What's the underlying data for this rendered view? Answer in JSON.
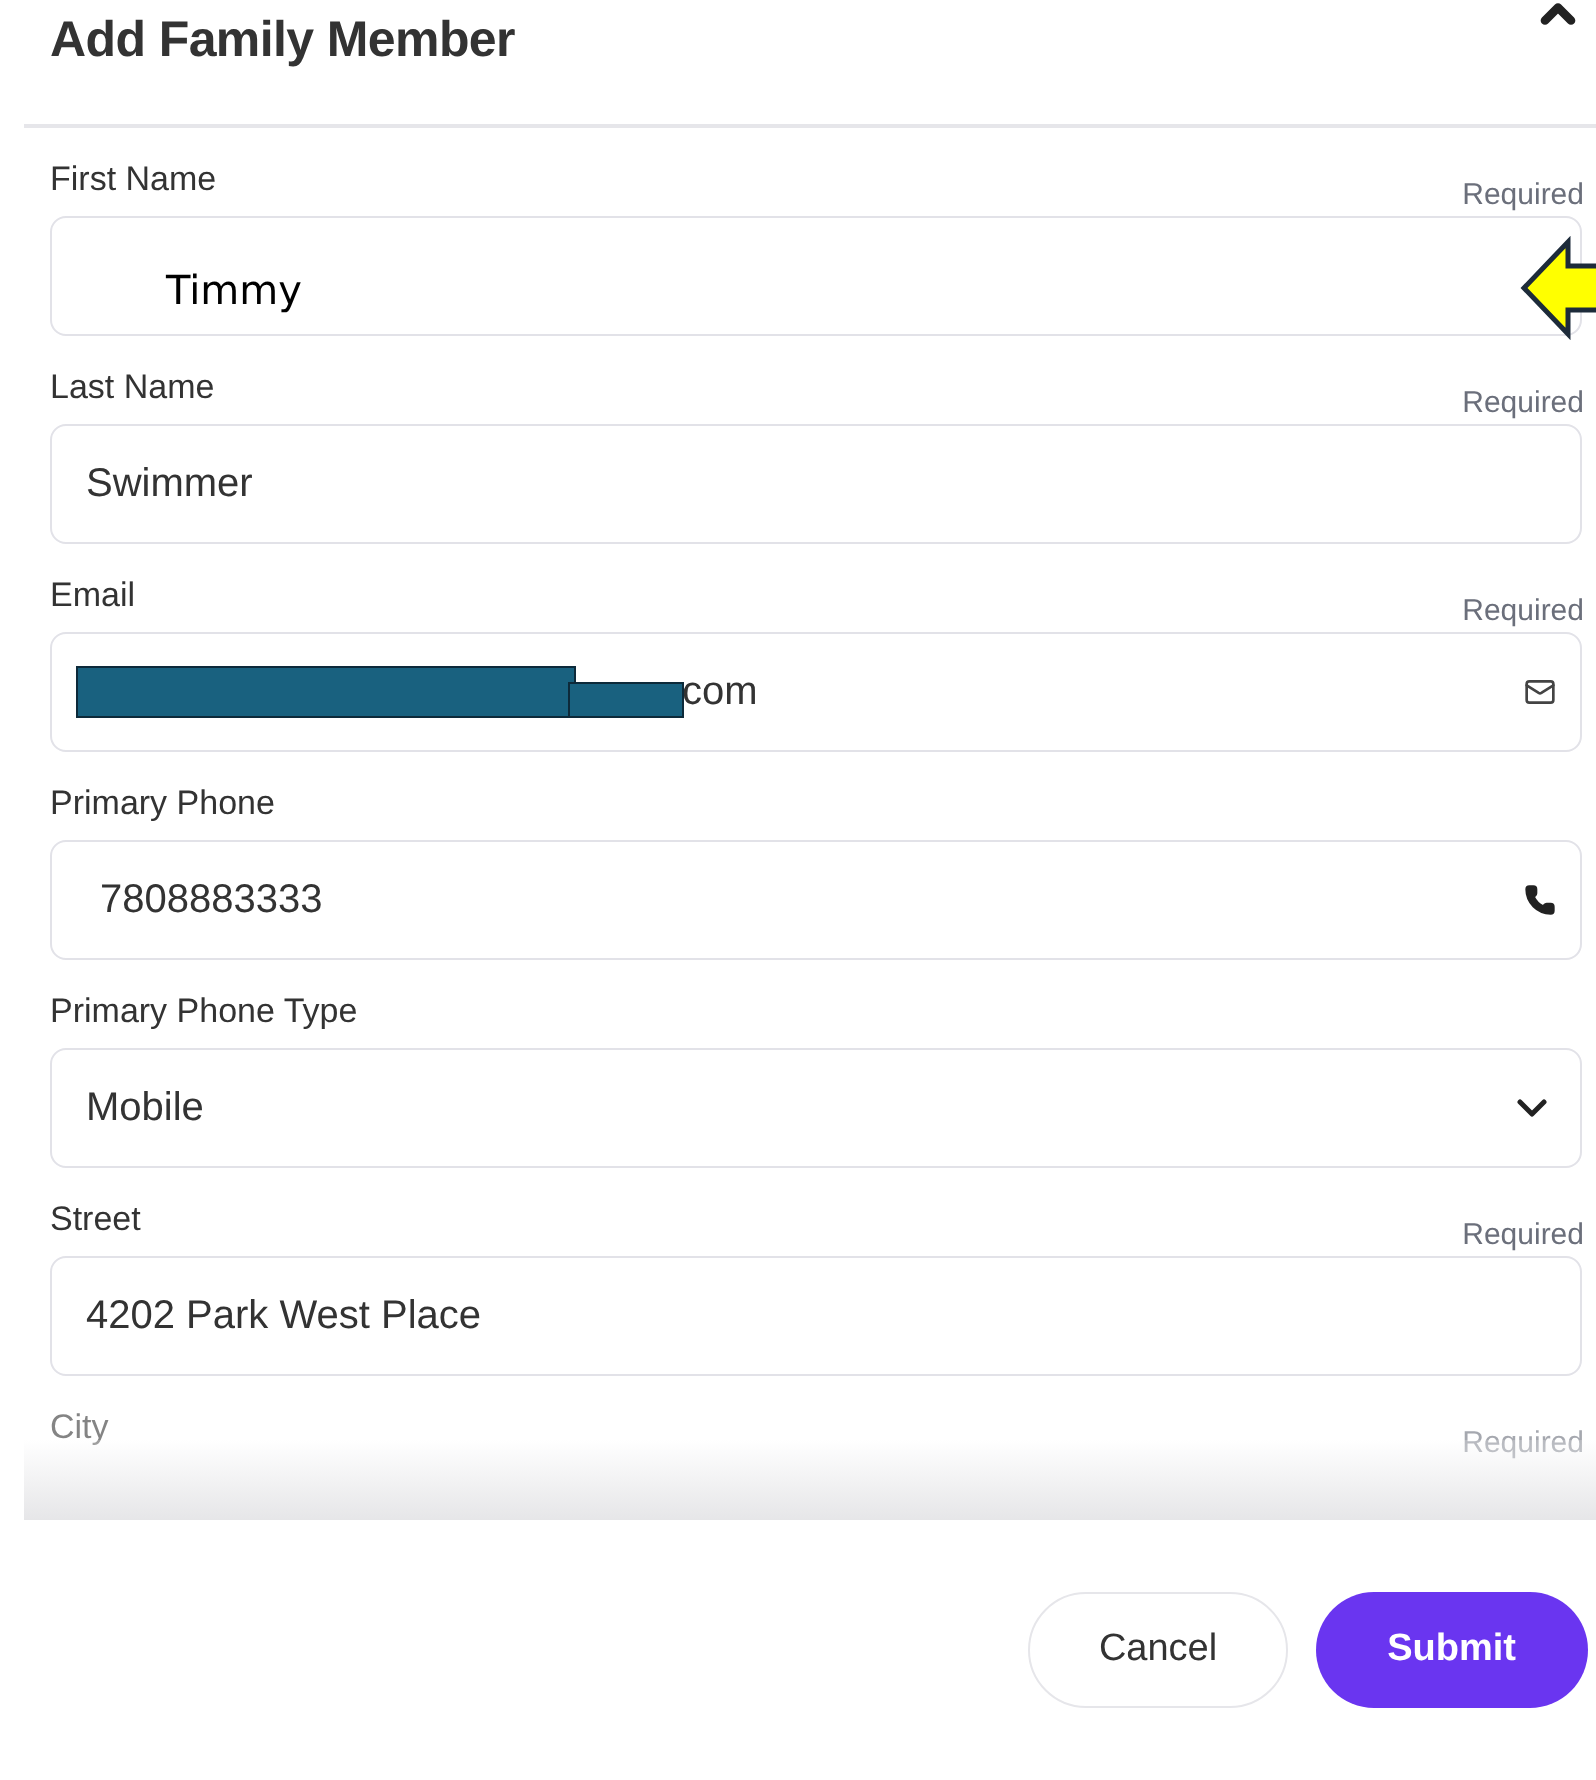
{
  "dialog": {
    "title": "Add Family Member"
  },
  "fields": [
    {
      "kind": "text",
      "label": "First Name",
      "required_note": "Required",
      "value": "Timmy",
      "annotated": true
    },
    {
      "kind": "text",
      "label": "Last Name",
      "required_note": "Required",
      "value": "Swimmer"
    },
    {
      "kind": "email",
      "label": "Email",
      "required_note": "Required",
      "value": "com",
      "redacted": true
    },
    {
      "kind": "phone",
      "label": "Primary Phone",
      "value": "7808883333"
    },
    {
      "kind": "select",
      "label": "Primary Phone Type",
      "value": "Mobile"
    },
    {
      "kind": "text",
      "label": "Street",
      "required_note": "Required",
      "value": "4202 Park West Place"
    },
    {
      "kind": "cut",
      "label": "City",
      "required_note": "Required"
    }
  ],
  "buttons": [
    {
      "kind": "secondary",
      "label": "Cancel"
    },
    {
      "kind": "primary",
      "label": "Submit"
    }
  ]
}
